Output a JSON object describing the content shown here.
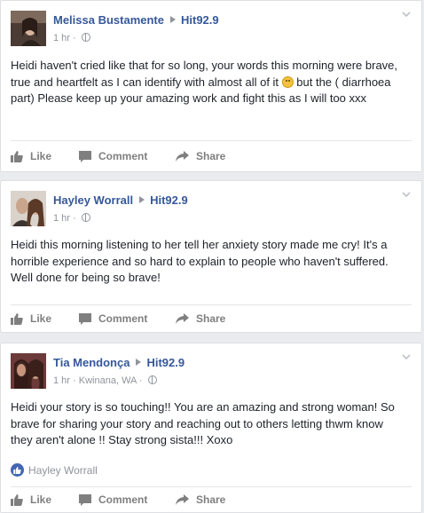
{
  "posts": [
    {
      "author": "Melissa Bustamente",
      "target": "Hit92.9",
      "time": "1 hr",
      "location": "",
      "text_before": "Heidi haven't cried like that for so long, your words this morning were brave, true and heartfelt as I can identify with almost all of it ",
      "text_after": " but the ( diarrhoea part) Please keep up your amazing work and fight this as I will too xxx",
      "emoji": "slightly-frowning-face-emoji"
    },
    {
      "author": "Hayley Worrall",
      "target": "Hit92.9",
      "time": "1 hr",
      "location": "",
      "text": "Heidi this morning listening to her tell her anxiety story made me cry! It's a horrible experience and so hard to explain to people who haven't suffered. Well done for being so brave!"
    },
    {
      "author": "Tia Mendonça",
      "target": "Hit92.9",
      "time": "1 hr",
      "location": "Kwinana, WA",
      "text": "Heidi your story is so touching!! You are an amazing and strong woman! So brave for sharing your story and reaching out to others letting thwm know they aren't alone !! Stay strong sista!!! Xoxo",
      "liked_by": "Hayley Worrall"
    }
  ],
  "actions": {
    "like": "Like",
    "comment": "Comment",
    "share": "Share"
  },
  "separator": "·",
  "icons": {
    "arrow": "triangle-right-icon",
    "globe": "globe-icon",
    "chevron": "chevron-down-icon",
    "like": "thumbs-up-icon",
    "comment": "speech-bubble-icon",
    "share": "share-arrow-icon"
  },
  "colors": {
    "link": "#365899",
    "meta": "#90949c",
    "action": "#7f7f7f",
    "like_badge": "#4267b2",
    "background": "#e9ebee"
  }
}
